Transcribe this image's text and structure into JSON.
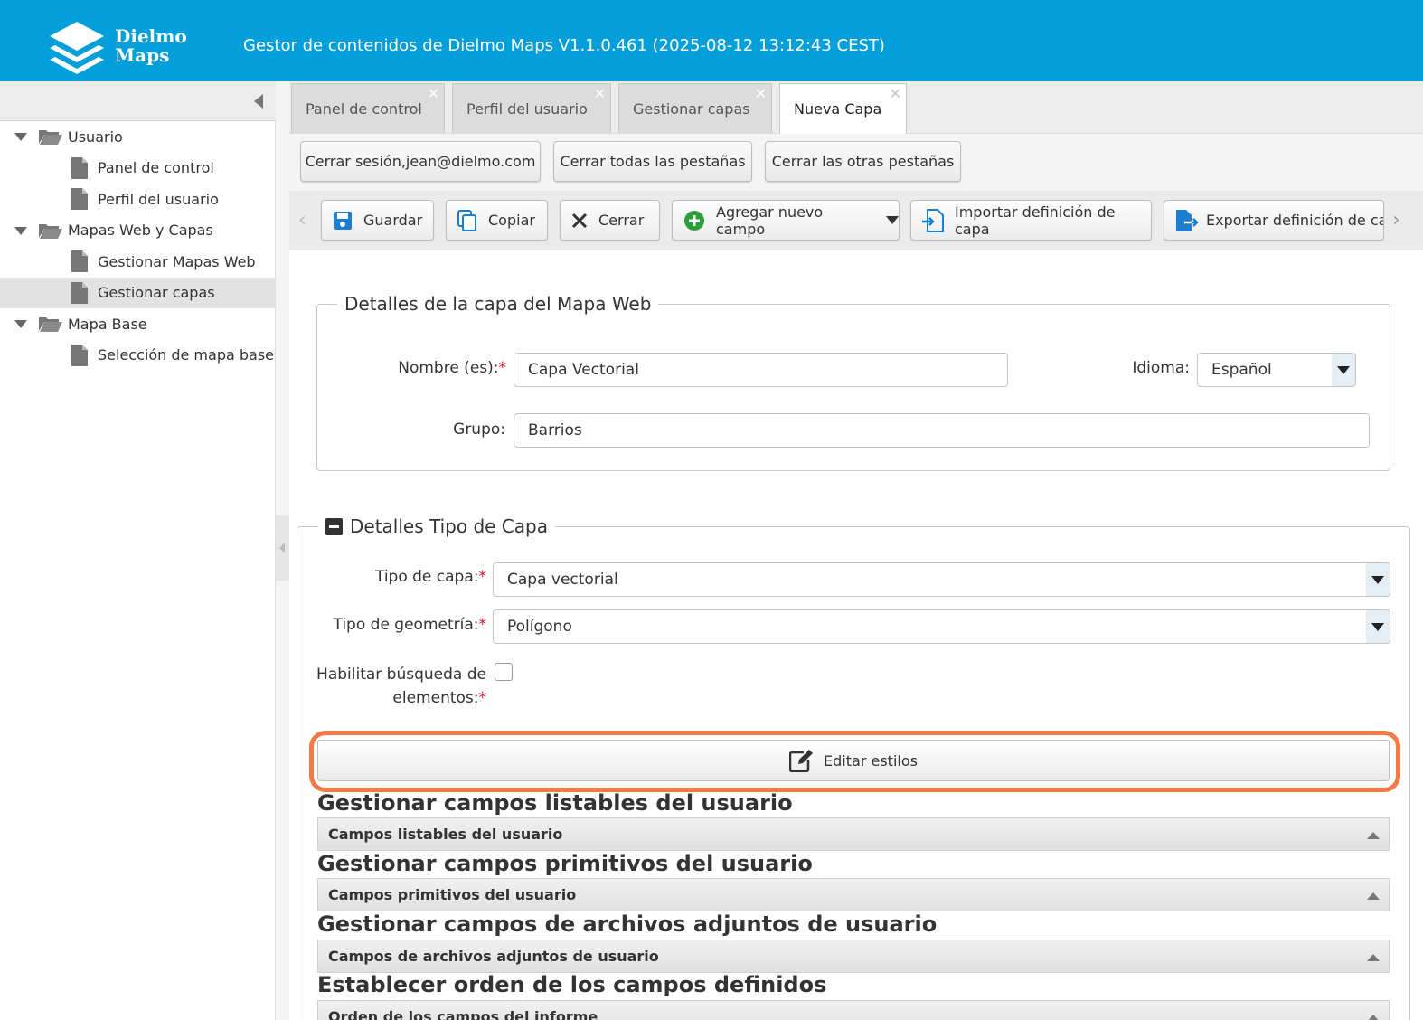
{
  "header": {
    "logo_line1": "Dielmo",
    "logo_line2": "Maps",
    "title": "Gestor de contenidos de Dielmo Maps V1.1.0.461 (2025-08-12 13:12:43 CEST)"
  },
  "sidebar": {
    "groups": [
      {
        "label": "Usuario",
        "items": [
          "Panel de control",
          "Perfil del usuario"
        ]
      },
      {
        "label": "Mapas Web y Capas",
        "items": [
          "Gestionar Mapas Web",
          "Gestionar capas"
        ]
      },
      {
        "label": "Mapa Base",
        "items": [
          "Selección de mapa base"
        ]
      }
    ],
    "selected": "Gestionar capas"
  },
  "tabs": [
    {
      "label": "Panel de control",
      "active": false
    },
    {
      "label": "Perfil del usuario",
      "active": false
    },
    {
      "label": "Gestionar capas",
      "active": false
    },
    {
      "label": "Nueva Capa",
      "active": true
    }
  ],
  "tab_close_glyph": "✕",
  "session": {
    "logout": "Cerrar sesión,jean@dielmo.com",
    "close_all": "Cerrar todas las pestañas",
    "close_others": "Cerrar las otras pestañas"
  },
  "toolbar": {
    "save": "Guardar",
    "copy": "Copiar",
    "close": "Cerrar",
    "add_field": "Agregar nuevo campo",
    "import": "Importar definición de capa",
    "export": "Exportar definición de capa"
  },
  "layer_details": {
    "legend": "Detalles de la capa del Mapa Web",
    "name_label": "Nombre (es):",
    "name_value": "Capa Vectorial",
    "language_label": "Idioma:",
    "language_value": "Español",
    "group_label": "Grupo:",
    "group_value": "Barrios"
  },
  "layer_type": {
    "legend": "Detalles Tipo de Capa",
    "type_label": "Tipo de capa:",
    "type_value": "Capa vectorial",
    "geometry_label": "Tipo de geometría:",
    "geometry_value": "Polígono",
    "search_label_line1": "Habilitar búsqueda de",
    "search_label_line2": "elementos:",
    "search_enabled": false,
    "edit_styles": "Editar estilos"
  },
  "required_mark": "*",
  "sections": [
    {
      "title": "Gestionar campos listables del usuario",
      "grid": "Campos listables del usuario"
    },
    {
      "title": "Gestionar campos primitivos del usuario",
      "grid": "Campos primitivos del usuario"
    },
    {
      "title": "Gestionar campos de archivos adjuntos de usuario",
      "grid": "Campos de archivos adjuntos de usuario"
    },
    {
      "title": "Establecer orden de los campos definidos",
      "grid": "Orden de los campos del informe"
    }
  ],
  "colors": {
    "header": "#039fdb",
    "highlight": "#f37a45",
    "required": "#d9141f",
    "add_icon": "#2e9e3a",
    "icon_blue": "#1a7fd1"
  }
}
